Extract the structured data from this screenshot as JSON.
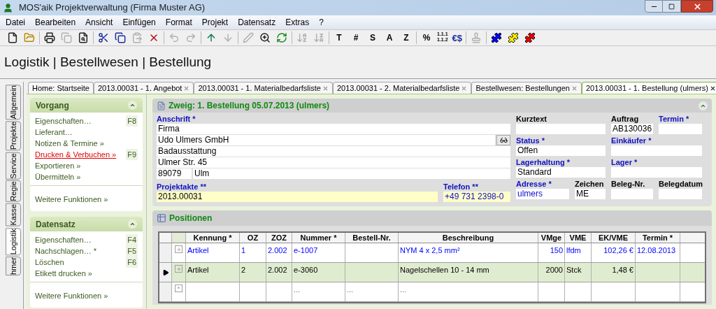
{
  "window": {
    "title": "MOS'aik Projektverwaltung (Firma Muster AG)"
  },
  "menu": [
    {
      "label": "Datei"
    },
    {
      "label": "Bearbeiten"
    },
    {
      "label": "Ansicht"
    },
    {
      "label": "Einfügen"
    },
    {
      "label": "Format"
    },
    {
      "label": "Projekt"
    },
    {
      "label": "Datensatz"
    },
    {
      "label": "Extras"
    },
    {
      "label": "?"
    }
  ],
  "toolbar": [
    [
      {
        "kind": "icon",
        "disabled": false
      },
      {
        "kind": "icon",
        "disabled": false
      }
    ],
    [
      {
        "kind": "icon",
        "disabled": false
      },
      {
        "kind": "icon",
        "disabled": true
      },
      {
        "kind": "icon",
        "disabled": false
      }
    ],
    [
      {
        "kind": "icon",
        "disabled": false
      },
      {
        "kind": "icon",
        "disabled": false
      },
      {
        "kind": "icon",
        "disabled": true
      },
      {
        "kind": "icon",
        "disabled": false
      }
    ],
    [
      {
        "kind": "icon",
        "disabled": true
      },
      {
        "kind": "icon",
        "disabled": true
      }
    ],
    [
      {
        "kind": "icon",
        "disabled": false
      },
      {
        "kind": "icon",
        "disabled": true
      }
    ],
    [
      {
        "kind": "icon",
        "disabled": true
      },
      {
        "kind": "icon",
        "disabled": false
      },
      {
        "kind": "icon",
        "disabled": false
      }
    ],
    [
      {
        "kind": "icon",
        "disabled": true
      },
      {
        "kind": "icon",
        "disabled": true
      }
    ],
    [
      {
        "kind": "text",
        "label": "T"
      },
      {
        "kind": "text",
        "label": "#"
      },
      {
        "kind": "text",
        "label": "S"
      },
      {
        "kind": "text",
        "label": "A"
      },
      {
        "kind": "text",
        "label": "Z"
      }
    ],
    [
      {
        "kind": "text",
        "label": "%"
      },
      {
        "kind": "stacked",
        "lines": [
          "1.1.1",
          "1.1.2"
        ]
      },
      {
        "kind": "currency",
        "label": "€$"
      }
    ],
    [
      {
        "kind": "icon",
        "disabled": true
      }
    ],
    [
      {
        "kind": "puzzle",
        "color": "#0000ff"
      },
      {
        "kind": "puzzle",
        "color": "#ffee00"
      },
      {
        "kind": "puzzle",
        "color": "#ee0000"
      }
    ]
  ],
  "breadcrumb": "Logistik | Bestellwesen | Bestellung",
  "side_tabs": [
    {
      "label": "Allgemein",
      "selected": false
    },
    {
      "label": "Projekte",
      "selected": false
    },
    {
      "label": "Service",
      "selected": false
    },
    {
      "label": "Regie",
      "selected": false
    },
    {
      "label": "Kasse",
      "selected": false
    },
    {
      "label": "Logistik",
      "selected": true
    },
    {
      "label": "hmer",
      "selected": false
    }
  ],
  "doc_tabs": [
    {
      "label": "Home: Startseite",
      "selected": false,
      "closable": false
    },
    {
      "label": "2013.00031 - 1. Angebot",
      "selected": false,
      "closable": true
    },
    {
      "label": "2013.00031 - 1. Materialbedarfsliste",
      "selected": false,
      "closable": true
    },
    {
      "label": "2013.00031 - 2. Materialbedarfsliste",
      "selected": false,
      "closable": true
    },
    {
      "label": "Bestellwesen: Bestellungen",
      "selected": false,
      "closable": true
    },
    {
      "label": "2013.00031 - 1. Bestellung (ulmers)",
      "selected": true,
      "closable": true
    }
  ],
  "sidebar": [
    {
      "title": "Vorgang",
      "expanded": true,
      "items": [
        {
          "label": "Eigenschaften…",
          "shortcut": "F8",
          "active": false
        },
        {
          "label": "Lieferant…",
          "active": false
        },
        {
          "label": "Notizen & Termine »",
          "active": false
        },
        {
          "label": "Drucken & Verbuchen »",
          "shortcut": "F9",
          "active": true
        },
        {
          "label": "Exportieren »",
          "active": false
        },
        {
          "label": "Übermitteln »",
          "active": false
        }
      ],
      "more": "Weitere Funktionen »"
    },
    {
      "title": "Datensatz",
      "expanded": true,
      "items": [
        {
          "label": "Eigenschaften…",
          "shortcut": "F4",
          "active": false
        },
        {
          "label": "Nachschlagen…",
          "marker": "*",
          "shortcut": "F5",
          "active": false
        },
        {
          "label": "Löschen",
          "shortcut": "F6",
          "active": false
        },
        {
          "label": "Etikett drucken »",
          "active": false
        }
      ],
      "more": "Weitere Funktionen »"
    }
  ],
  "form": {
    "title": "Zweig: 1. Bestellung 05.07.2013 (ulmers)",
    "expanded": true,
    "address": {
      "label": "Anschrift",
      "marker": "*",
      "lines": [
        "Firma",
        "Udo Ulmers GmbH",
        "Badausstattung",
        "Ulmer Str. 45"
      ],
      "zip": "89079",
      "city": "Ulm"
    },
    "projektakte": {
      "label": "Projektakte",
      "marker": "**",
      "value": "2013.00031"
    },
    "telefon": {
      "label": "Telefon",
      "marker": "**",
      "value": "+49 731 2398-0"
    },
    "fields": [
      {
        "label": "Kurztext",
        "required": false
      },
      {
        "label": "Auftrag",
        "required": false,
        "value": "AB130036"
      },
      {
        "label": "Termin",
        "required": true
      },
      {
        "label": "Status",
        "required": true,
        "value": "Offen"
      },
      {
        "label": "Einkäufer",
        "required": true
      },
      {
        "label": "Lagerhaltung",
        "required": true,
        "value": "Standard"
      },
      {
        "label": "Lager",
        "required": true
      },
      {
        "label": "Adresse",
        "required": true,
        "value": "ulmers"
      },
      {
        "label": "Zeichen",
        "required": false,
        "value": "ME"
      },
      {
        "label": "Beleg-Nr.",
        "required": false
      },
      {
        "label": "Belegdatum",
        "required": false
      }
    ]
  },
  "positions": {
    "title": "Positionen",
    "columns": [
      {
        "label": "Kennung *"
      },
      {
        "label": "OZ"
      },
      {
        "label": "ZOZ"
      },
      {
        "label": "Nummer *"
      },
      {
        "label": "Bestell-Nr."
      },
      {
        "label": "Beschreibung"
      },
      {
        "label": "VMge"
      },
      {
        "label": "VME"
      },
      {
        "label": "EK/VME"
      },
      {
        "label": "Termin *"
      }
    ],
    "rows": [
      {
        "kind": "item",
        "selected": false,
        "color": "#0000ff",
        "cells": [
          "Artikel",
          "1",
          "2.002",
          "e-1007",
          "",
          "NYM 4 x 2,5 mm²",
          "150",
          "lfdm",
          "102,26 €",
          "12.08.2013"
        ]
      },
      {
        "kind": "item",
        "selected": true,
        "color": "#000000",
        "cells": [
          "Artikel",
          "2",
          "2.002",
          "e-3060",
          "",
          "Nagelschellen 10 - 14 mm",
          "2000",
          "Stck",
          "1,48 €",
          ""
        ]
      },
      {
        "kind": "new",
        "selected": false,
        "color": "#8060a0",
        "cells": [
          "",
          "",
          "",
          "...",
          "...",
          "...",
          "",
          "",
          "",
          ""
        ]
      }
    ]
  }
}
